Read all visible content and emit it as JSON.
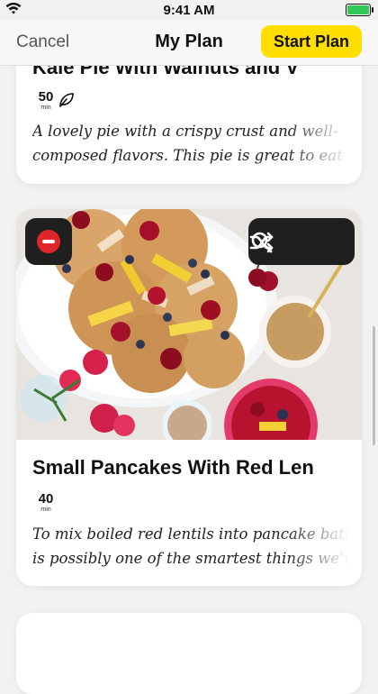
{
  "status": {
    "time": "9:41 AM"
  },
  "nav": {
    "cancel": "Cancel",
    "title": "My Plan",
    "start": "Start Plan"
  },
  "cards": [
    {
      "title": "Kale Pie With Walnuts and V",
      "minutes": "50",
      "min_unit": "min",
      "icon": "leaf-icon",
      "desc_lines": [
        "A lovely pie with a crispy crust and well-",
        "composed flavors.  This pie is great to eat to"
      ]
    },
    {
      "title": "Small Pancakes With Red Len",
      "minutes": "40",
      "min_unit": "min",
      "desc_lines": [
        "To mix boiled red lentils into pancake batter",
        "is possibly one of the smartest things we've"
      ],
      "image": "photo of pancakes with fruits, nut butter and flowers"
    }
  ],
  "colors": {
    "accent": "#ffde00",
    "remove": "#e0252b",
    "battery": "#34c759"
  }
}
